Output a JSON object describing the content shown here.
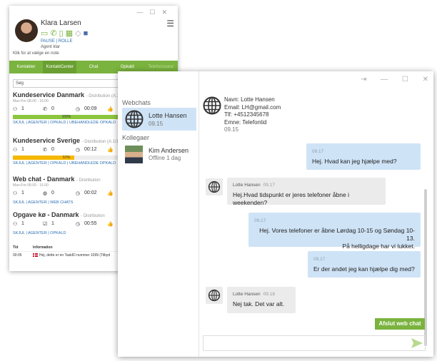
{
  "agent_window": {
    "titlebar": {
      "minimize": "—",
      "restore": "☐",
      "close": "✕"
    },
    "user": {
      "name": "Klara Larsen",
      "pause_role": "PAUSE | ROLLE",
      "status": "Agent klar",
      "note_prompt": "Klik for at vælge en note"
    },
    "nav_tabs": [
      "Kontakter",
      "KontaktCenter",
      "Chat",
      "Opkald",
      "Telefonsvarer"
    ],
    "search_value": "Søg",
    "queues": [
      {
        "title": "Kundeservice Danmark",
        "subtitle": "- Distribution (A:1/1 -",
        "hours": "Man-Fre 08.00 - 16.00",
        "agents": "1",
        "calls": "0",
        "wait": "00:09",
        "progress_label": "100%",
        "progress": 1.0,
        "progress_color": "#8cc63f",
        "links": "SKJUL | AGENTER | OPKALD | UBEHANDLEDE OPKALD"
      },
      {
        "title": "Kundeservice Sverige",
        "subtitle": "- Distribution (A:1/1 -",
        "hours": "",
        "agents": "1",
        "calls": "0",
        "wait": "00:12",
        "progress_label": "57%",
        "progress": 0.57,
        "progress_color": "#f5b800",
        "links": "SKJUL | AGENTER | OPKALD | UBEHANDLEDE OPKALD"
      },
      {
        "title": "Web chat - Danmark",
        "subtitle": "- Distribution",
        "hours": "Man-Fre 08.00 - 16.00",
        "agents": "1",
        "calls": "0",
        "wait": "00:02",
        "progress_label": "",
        "progress": 0,
        "progress_color": "#8cc63f",
        "links": "SKJUL | AGENTER | WEB CHATS"
      },
      {
        "title": "Opgave kø - Danmark",
        "subtitle": "- Distribution",
        "hours": "",
        "agents": "1",
        "calls": "1",
        "wait": "00:55",
        "progress_label": "",
        "progress": 0,
        "progress_color": "#8cc63f",
        "links": "SKJUL | AGENTER | OPKALD"
      }
    ],
    "task_table": {
      "headers": [
        "Tid",
        "Information"
      ],
      "rows": [
        {
          "time": "00:05",
          "info": "Hej, dette er en TaskID nummer 1099 (Tilbyd"
        }
      ]
    }
  },
  "chat_window": {
    "titlebar": {
      "pin": "⇥",
      "minimize": "—",
      "restore": "☐",
      "close": "✕"
    },
    "webchats_label": "Webchats",
    "active_chat": {
      "name": "Lotte Hansen",
      "time": "09.15"
    },
    "colleagues_label": "Kollegaer",
    "colleague": {
      "name": "Kim Andersen",
      "status": "Offline 1 dag"
    },
    "contact_info": {
      "name": "Navn: Lotte Hansen",
      "email": "Email: LH@gmail.com",
      "phone": "Tlf: +4512345678",
      "subject": "Emne: Telefontid",
      "time": "09.15"
    },
    "messages": [
      {
        "dir": "out",
        "time": "09.17",
        "text1": "Hej. Hvad kan jeg hjælpe med?",
        "text2": ""
      },
      {
        "dir": "in",
        "sender": "Lotte Hansen",
        "time": "09.17",
        "text1": "Hej.Hvad tidspunkt er jeres telefoner åbne i weekenden?",
        "text2": ""
      },
      {
        "dir": "out",
        "time": "09.17",
        "text1": "Hej. Vores telefoner er åbne Lørdag 10-15 og Søndag 10-13.",
        "text2": "På helligdage har vi lukket."
      },
      {
        "dir": "out",
        "time": "09.17",
        "text1": "Er der andet jeg kan hjælpe dig med?",
        "text2": ""
      },
      {
        "dir": "in",
        "sender": "Lotte Hansen",
        "time": "09.18",
        "text1": "Nej tak. Det var alt.",
        "text2": ""
      }
    ],
    "end_button": "Afslut web chat",
    "input_placeholder": ""
  },
  "colors": {
    "accent_green": "#7ab33e",
    "selected_blue": "#cfe3f6",
    "link_blue": "#2a6fb3"
  }
}
